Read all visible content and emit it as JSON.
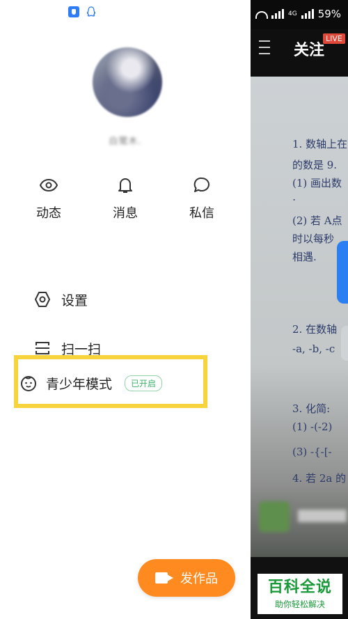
{
  "left_status": {
    "icons": [
      "shield-icon",
      "qq-icon"
    ]
  },
  "profile": {
    "username": "白鹭木."
  },
  "quick_actions": [
    {
      "label": "动态",
      "icon": "eye-icon"
    },
    {
      "label": "消息",
      "icon": "bell-icon"
    },
    {
      "label": "私信",
      "icon": "chat-icon"
    }
  ],
  "menu": {
    "settings": "设置",
    "scan": "扫一扫",
    "youth_mode": "青少年模式",
    "youth_badge": "已开启"
  },
  "publish_button": "发作品",
  "right_panel": {
    "status": {
      "battery": "59%",
      "network": "4G"
    },
    "header": {
      "title": "关注",
      "live_badge": "LIVE"
    },
    "handwriting_lines": [
      "1. 数轴上在",
      "的数是 9.",
      "(1) 画出数",
      "⋅",
      "(2) 若 A点",
      "时以每秒",
      "相遇.",
      "2. 在数轴",
      "-a, -b, -c",
      "3. 化简:",
      "(1) -(-2)",
      "(3) -{-[-",
      "4. 若 2a 的"
    ]
  },
  "watermark": {
    "title": "百科全说",
    "subtitle": "助你轻松解决"
  },
  "colors": {
    "accent": "#ff8a1f",
    "highlight": "#f7d43b",
    "badge_green": "#3eb26a",
    "live_red": "#e0483a"
  }
}
